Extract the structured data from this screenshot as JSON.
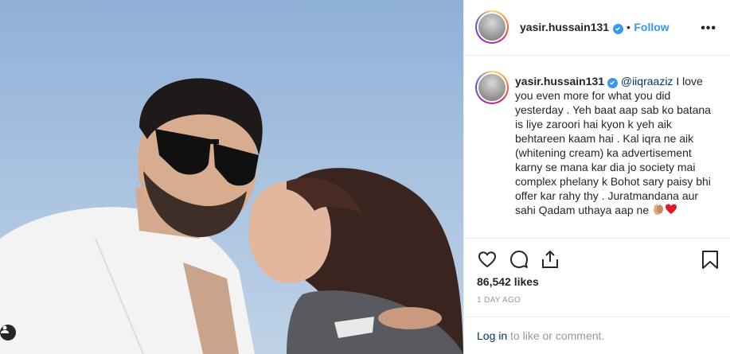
{
  "post": {
    "username": "yasir.hussain131",
    "follow_label": "Follow",
    "separator": "•",
    "more_label": "•••"
  },
  "caption": {
    "username": "yasir.hussain131",
    "mention": "@iiqraaziz",
    "text": " I love you even more for what you did yesterday . Yeh baat aap sab ko batana is liye zaroori hai kyon k yeh aik behtareen kaam hai . Kal iqra ne aik (whitening cream) ka advertisement karny se mana kar dia jo society mai complex phelany k Bohot sary paisy bhi offer kar rahy thy . Juratmandana aur sahi Qadam uthaya aap ne ",
    "emojis": [
      "clapping-hands",
      "red-heart"
    ]
  },
  "stats": {
    "likes": "86,542 likes",
    "time": "1 DAY AGO"
  },
  "footer": {
    "login_link": "Log in",
    "login_text": " to like or comment."
  },
  "colors": {
    "accent": "#3897f0",
    "link": "#003569",
    "muted": "#999999",
    "border": "#efefef"
  },
  "icons": [
    "verified-badge-icon",
    "heart-icon",
    "comment-icon",
    "share-icon",
    "bookmark-icon",
    "user-tag-icon",
    "more-options-icon"
  ]
}
